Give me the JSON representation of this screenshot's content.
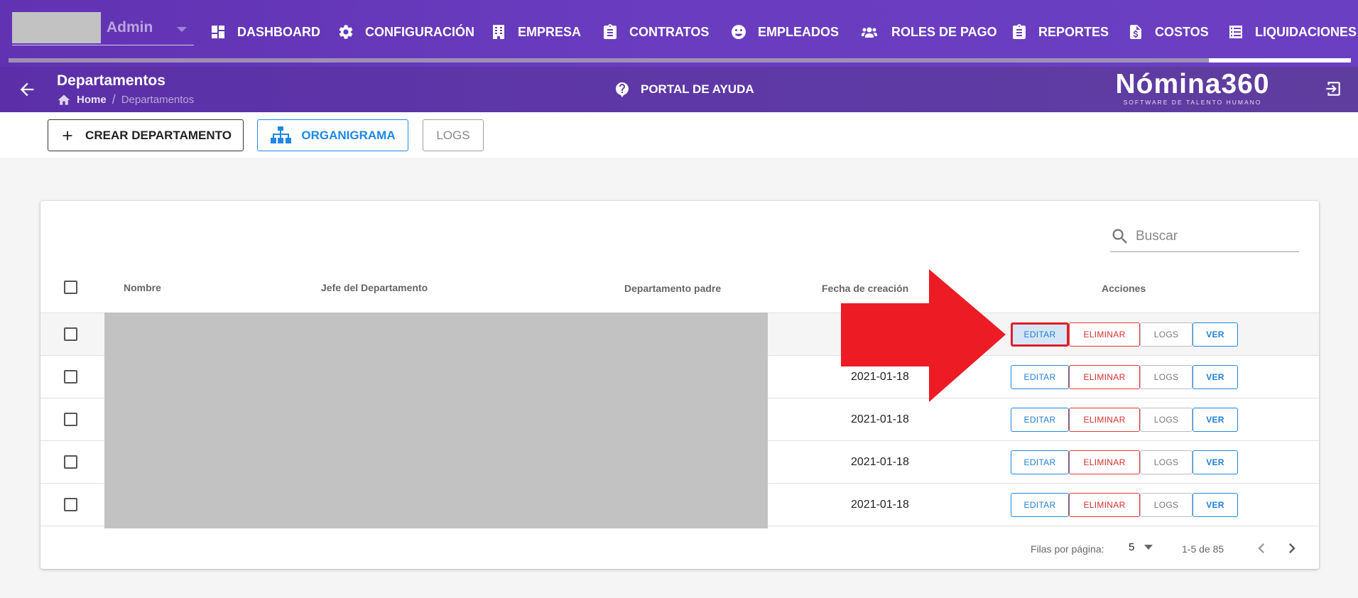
{
  "user": {
    "name": "Admin"
  },
  "nav": {
    "items": [
      {
        "label": "DASHBOARD",
        "icon": "dashboard-icon"
      },
      {
        "label": "CONFIGURACIÓN",
        "icon": "gear-icon"
      },
      {
        "label": "EMPRESA",
        "icon": "building-icon"
      },
      {
        "label": "CONTRATOS",
        "icon": "clipboard-icon"
      },
      {
        "label": "EMPLEADOS",
        "icon": "face-icon"
      },
      {
        "label": "ROLES DE PAGO",
        "icon": "users-icon"
      },
      {
        "label": "REPORTES",
        "icon": "clipboard-icon"
      },
      {
        "label": "COSTOS",
        "icon": "invoice-dollar-icon"
      },
      {
        "label": "LIQUIDACIONES",
        "icon": "list-icon"
      }
    ]
  },
  "page": {
    "title": "Departamentos",
    "breadcrumb": {
      "home": "Home",
      "separator": "/",
      "current": "Departamentos"
    },
    "help_label": "PORTAL DE AYUDA"
  },
  "brand": {
    "name": "Nómina360",
    "tagline": "SOFTWARE DE TALENTO HUMANO"
  },
  "toolbar": {
    "create_label": "CREAR DEPARTAMENTO",
    "org_label": "ORGANIGRAMA",
    "logs_label": "LOGS"
  },
  "search": {
    "placeholder": "Buscar",
    "value": ""
  },
  "table": {
    "headers": {
      "name": "Nombre",
      "boss": "Jefe del Departamento",
      "parent": "Departamento padre",
      "created": "Fecha de creación",
      "actions": "Acciones"
    },
    "action_labels": {
      "edit": "EDITAR",
      "delete": "ELIMINAR",
      "logs": "LOGS",
      "view": "VER"
    },
    "rows": [
      {
        "created": ""
      },
      {
        "created": "2021-01-18"
      },
      {
        "created": "2021-01-18"
      },
      {
        "created": "2021-01-18"
      },
      {
        "created": "2021-01-18"
      }
    ]
  },
  "pagination": {
    "rows_per_page_label": "Filas por página:",
    "rows_per_page": "5",
    "range": "1-5 de 85"
  },
  "colors": {
    "nav_bg": "#6a3cc0",
    "primary_blue": "#1e88e5",
    "danger_red": "#e53935",
    "annotation_red": "#ed1c24"
  }
}
